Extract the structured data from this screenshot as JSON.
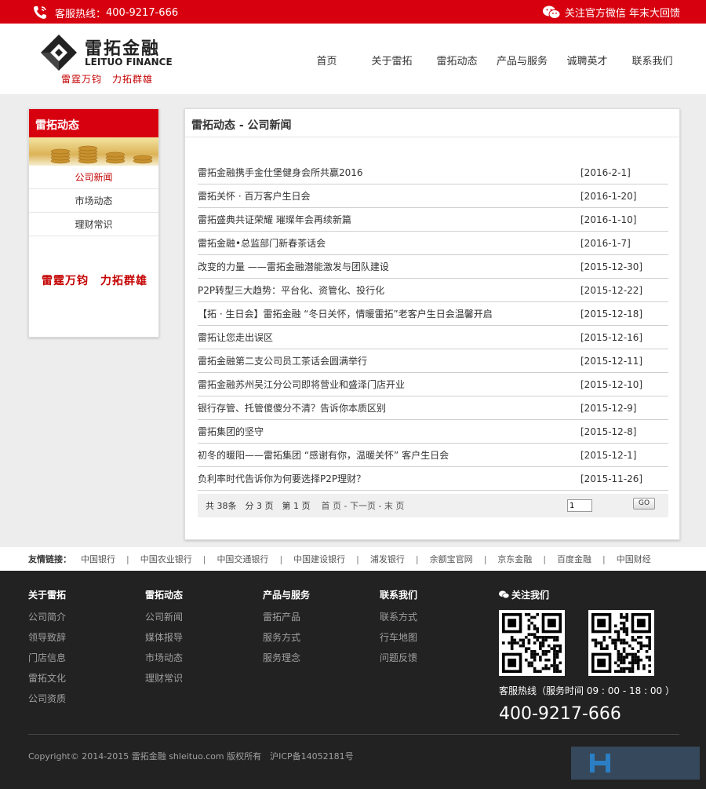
{
  "topbar": {
    "hotline_label": "客服热线：",
    "hotline": "400-9217-666",
    "wechat_text": "关注官方微信 年末大回馈"
  },
  "brand": {
    "name_cn": "雷拓金融",
    "name_en": "LEITUO FINANCE",
    "slogan": "雷霆万钧　力拓群雄"
  },
  "nav": [
    "首页",
    "关于雷拓",
    "雷拓动态",
    "产品与服务",
    "诚聘英才",
    "联系我们"
  ],
  "sidebar": {
    "title": "雷拓动态",
    "items": [
      "公司新闻",
      "市场动态",
      "理财常识"
    ],
    "active_index": 0,
    "slogan": "雷霆万钧　力拓群雄"
  },
  "main": {
    "title": "雷拓动态 - 公司新闻",
    "news": [
      {
        "title": "雷拓金融携手金仕堡健身会所共赢2016",
        "date": "[2016-2-1]"
      },
      {
        "title": "雷拓关怀 · 百万客户生日会",
        "date": "[2016-1-20]"
      },
      {
        "title": "雷拓盛典共证荣耀 璀璨年会再续新篇",
        "date": "[2016-1-10]"
      },
      {
        "title": "雷拓金融•总监部门新春茶话会",
        "date": "[2016-1-7]"
      },
      {
        "title": "改变的力量 ——雷拓金融潜能激发与团队建设",
        "date": "[2015-12-30]"
      },
      {
        "title": "P2P转型三大趋势：平台化、资管化、投行化",
        "date": "[2015-12-22]"
      },
      {
        "title": "【拓 · 生日会】雷拓金融 “冬日关怀，情暖雷拓”老客户生日会温馨开启",
        "date": "[2015-12-18]"
      },
      {
        "title": "雷拓让您走出误区",
        "date": "[2015-12-16]"
      },
      {
        "title": "雷拓金融第二支公司员工茶话会圆满举行",
        "date": "[2015-12-11]"
      },
      {
        "title": "雷拓金融苏州吴江分公司即将营业和盛泽门店开业",
        "date": "[2015-12-10]"
      },
      {
        "title": "银行存管、托管傻傻分不清？告诉你本质区别",
        "date": "[2015-12-9]"
      },
      {
        "title": "雷拓集团的坚守",
        "date": "[2015-12-8]"
      },
      {
        "title": "初冬的暖阳——雷拓集团 “感谢有你，温暖关怀” 客户生日会",
        "date": "[2015-12-1]"
      },
      {
        "title": "负利率时代告诉你为何要选择P2P理财？",
        "date": "[2015-11-26]"
      }
    ],
    "pager": {
      "info": "共 38条　分 3 页　第 1 页",
      "links": "首 页 - 下一页 - 末 页",
      "page_value": "1",
      "go_label": "GO"
    }
  },
  "friends": {
    "label": "友情链接：",
    "links": [
      "中国银行",
      "中国农业银行",
      "中国交通银行",
      "中国建设银行",
      "浦发银行",
      "余额宝官网",
      "京东金融",
      "百度金融",
      "中国财经"
    ]
  },
  "footer": {
    "columns": [
      {
        "title": "关于雷拓",
        "items": [
          "公司简介",
          "领导致辞",
          "门店信息",
          "雷拓文化",
          "公司资质"
        ]
      },
      {
        "title": "雷拓动态",
        "items": [
          "公司新闻",
          "媒体报导",
          "市场动态",
          "理财常识"
        ]
      },
      {
        "title": "产品与服务",
        "items": [
          "雷拓产品",
          "服务方式",
          "服务理念"
        ]
      },
      {
        "title": "联系我们",
        "items": [
          "联系方式",
          "行车地图",
          "问题反馈"
        ]
      }
    ],
    "follow_title": "关注我们",
    "service_text": "客服热线（服务时间 09 : 00 - 18 : 00 ）",
    "phone": "400-9217-666",
    "copyright": "Copyright© 2014-2015 雷拓金融 shleituo.com 版权所有　沪ICP备14052181号"
  },
  "colors": {
    "brand_red": "#d7000f",
    "footer_bg": "#222222"
  }
}
